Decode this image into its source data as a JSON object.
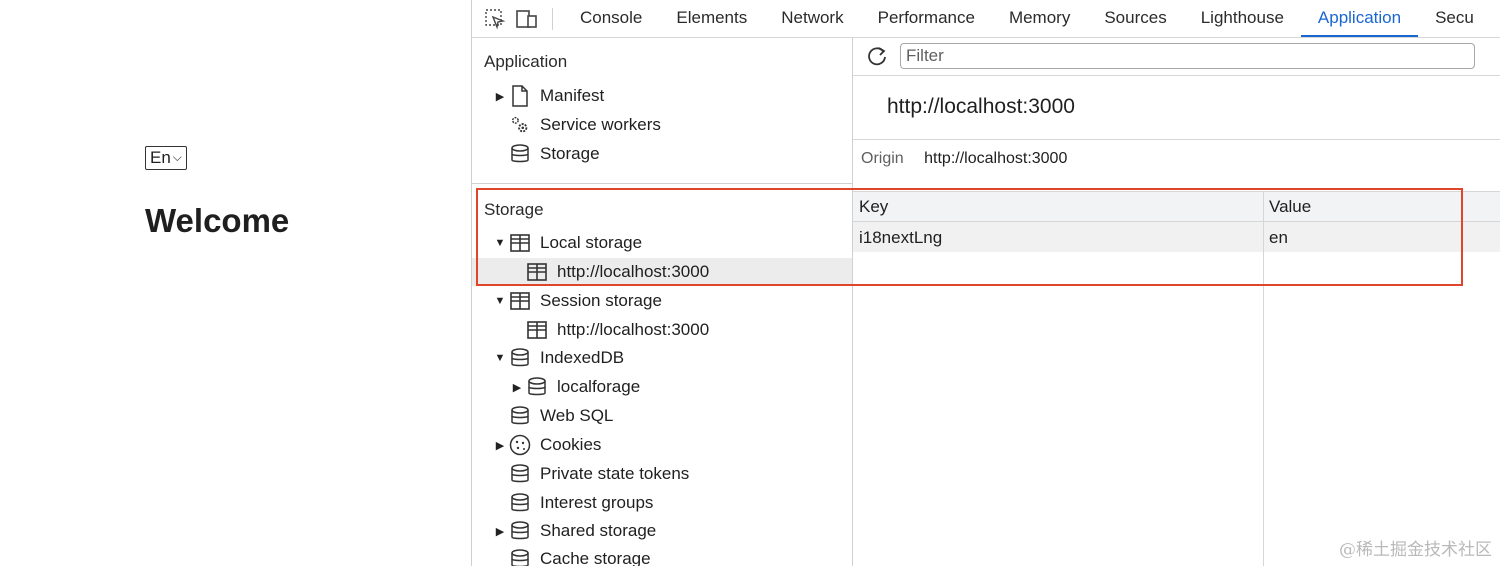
{
  "page": {
    "lang_select": "En",
    "welcome": "Welcome"
  },
  "devtools": {
    "tabs": [
      "Console",
      "Elements",
      "Network",
      "Performance",
      "Memory",
      "Sources",
      "Lighthouse",
      "Application",
      "Secu"
    ],
    "active_tab": "Application",
    "sidebar": {
      "application_title": "Application",
      "application_items": [
        "Manifest",
        "Service workers",
        "Storage"
      ],
      "storage_title": "Storage",
      "storage_items": [
        "Local storage",
        "http://localhost:3000",
        "Session storage",
        "http://localhost:3000",
        "IndexedDB",
        "localforage",
        "Web SQL",
        "Cookies",
        "Private state tokens",
        "Interest groups",
        "Shared storage",
        "Cache storage"
      ]
    },
    "main": {
      "filter_placeholder": "Filter",
      "origin_title": "http://localhost:3000",
      "origin_label": "Origin",
      "origin_value": "http://localhost:3000",
      "columns": [
        "Key",
        "Value"
      ],
      "rows": [
        {
          "key": "i18nextLng",
          "value": "en"
        }
      ]
    }
  },
  "watermark": "@稀土掘金技术社区",
  "colors": {
    "accent": "#1a66d2",
    "highlight": "#e0442b"
  }
}
